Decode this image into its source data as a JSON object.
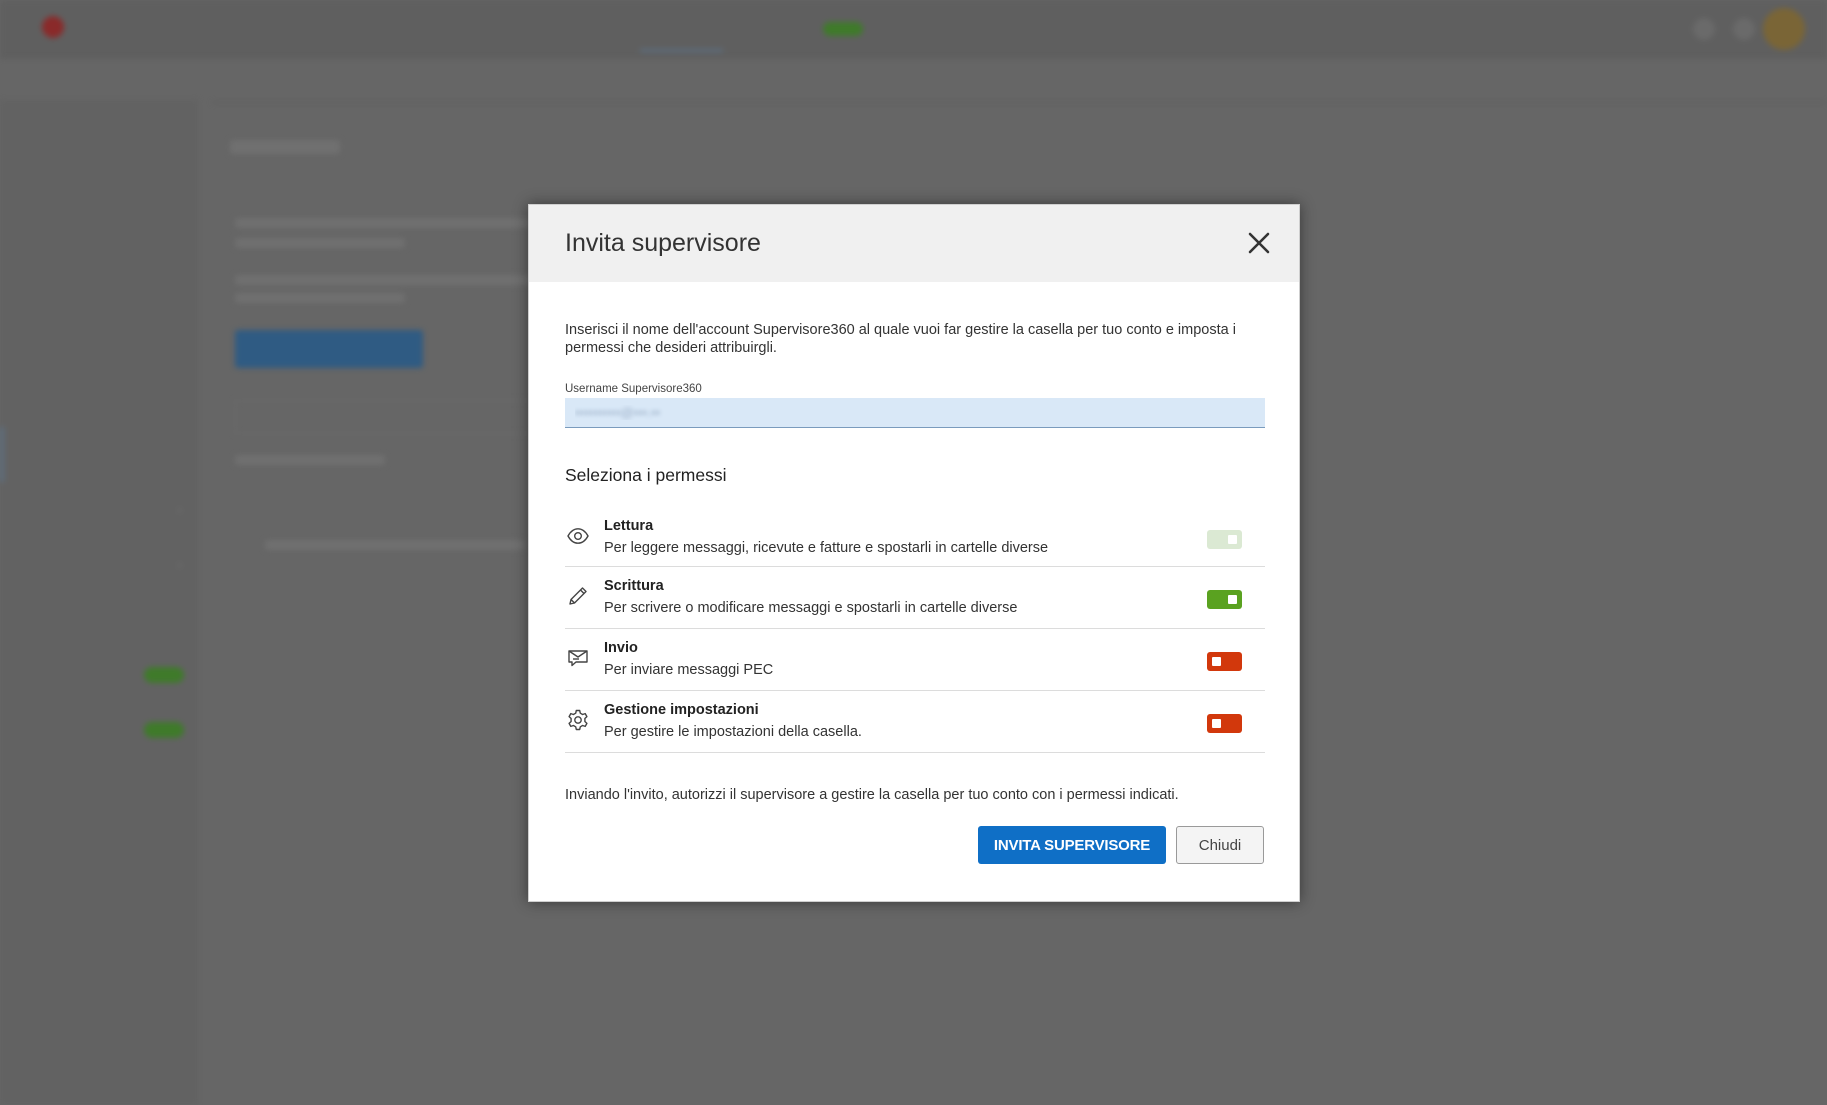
{
  "colors": {
    "overlay": "#666666",
    "primary": "#0f6fc6",
    "toggle_on": "#5aa220",
    "toggle_on_disabled": "#dbe9d3",
    "toggle_off": "#d2380c",
    "input_bg": "#d9e8f7"
  },
  "modal": {
    "title": "Invita supervisore",
    "intro": "Inserisci il nome dell'account Supervisore360 al quale vuoi far gestire la casella per tuo conto e imposta i permessi che desideri attribuirgli.",
    "field_label": "Username Supervisore360",
    "field_value": "••••••••••@•••.••",
    "permissions_title": "Seleziona i permessi",
    "permissions": [
      {
        "icon": "eye-icon",
        "name": "Lettura",
        "description": "Per leggere messaggi, ricevute e fatture e spostarli in cartelle diverse",
        "state": "on",
        "disabled": true
      },
      {
        "icon": "pencil-icon",
        "name": "Scrittura",
        "description": "Per scrivere o modificare messaggi e spostarli in cartelle diverse",
        "state": "on",
        "disabled": false
      },
      {
        "icon": "send-mail-icon",
        "name": "Invio",
        "description": "Per inviare messaggi PEC",
        "state": "off",
        "disabled": false
      },
      {
        "icon": "gear-icon",
        "name": "Gestione impostazioni",
        "description": "Per gestire le impostazioni della casella.",
        "state": "off",
        "disabled": false
      }
    ],
    "notice": "Inviando l'invito, autorizzi il supervisore a gestire la casella per tuo conto con i permessi indicati.",
    "primary_button": "INVITA SUPERVISORE",
    "secondary_button": "Chiudi"
  }
}
